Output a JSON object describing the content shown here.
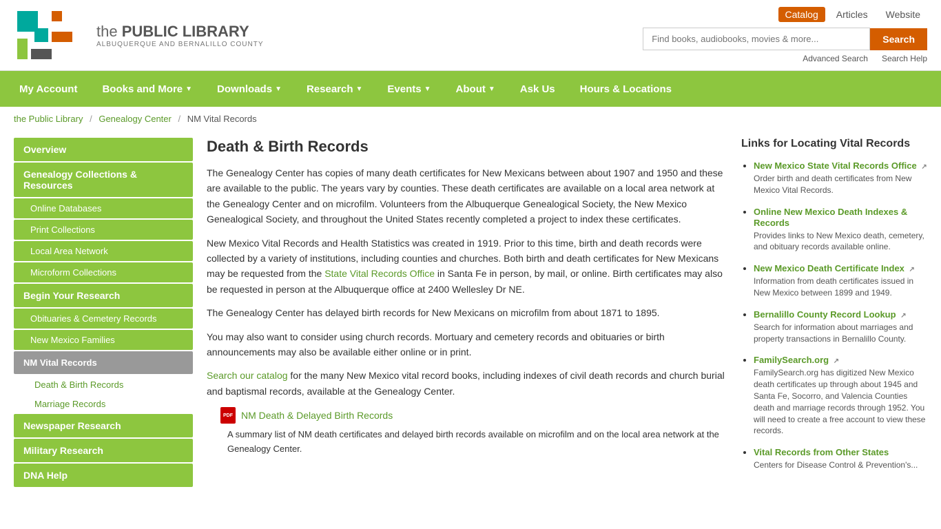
{
  "header": {
    "logo_title_the": "the ",
    "logo_title_main": "PUBLIC LIBRARY",
    "logo_subtitle": "ALBUQUERQUE and BERNALILLO COUNTY",
    "search_tabs": [
      {
        "label": "Catalog",
        "active": true
      },
      {
        "label": "Articles",
        "active": false
      },
      {
        "label": "Website",
        "active": false
      }
    ],
    "search_placeholder": "Find books, audiobooks, movies & more...",
    "search_button": "Search",
    "advanced_search": "Advanced Search",
    "search_help": "Search Help"
  },
  "nav": {
    "items": [
      {
        "label": "My Account",
        "has_arrow": false
      },
      {
        "label": "Books and More",
        "has_arrow": true
      },
      {
        "label": "Downloads",
        "has_arrow": true
      },
      {
        "label": "Research",
        "has_arrow": true
      },
      {
        "label": "Events",
        "has_arrow": true
      },
      {
        "label": "About",
        "has_arrow": true
      },
      {
        "label": "Ask Us",
        "has_arrow": false
      },
      {
        "label": "Hours & Locations",
        "has_arrow": false
      }
    ]
  },
  "breadcrumb": {
    "items": [
      {
        "label": "the Public Library",
        "link": true
      },
      {
        "label": "Genealogy Center",
        "link": true
      },
      {
        "label": "NM Vital Records",
        "link": false
      }
    ]
  },
  "sidebar": {
    "items": [
      {
        "label": "Overview",
        "type": "main"
      },
      {
        "label": "Genealogy Collections & Resources",
        "type": "main"
      },
      {
        "label": "Online Databases",
        "type": "sub"
      },
      {
        "label": "Print Collections",
        "type": "sub"
      },
      {
        "label": "Local Area Network",
        "type": "sub"
      },
      {
        "label": "Microform Collections",
        "type": "sub"
      },
      {
        "label": "Begin Your Research",
        "type": "main"
      },
      {
        "label": "Obituaries & Cemetery Records",
        "type": "sub"
      },
      {
        "label": "New Mexico Families",
        "type": "sub"
      },
      {
        "label": "NM Vital Records",
        "type": "active"
      },
      {
        "label": "Death & Birth Records",
        "type": "child"
      },
      {
        "label": "Marriage Records",
        "type": "child"
      },
      {
        "label": "Newspaper Research",
        "type": "main"
      },
      {
        "label": "Military Research",
        "type": "main"
      },
      {
        "label": "DNA Help",
        "type": "main"
      }
    ]
  },
  "main": {
    "title": "Death & Birth Records",
    "paragraphs": [
      "The Genealogy Center has copies of many death certificates for New Mexicans between about 1907 and 1950 and these are available to the public. The years vary by counties. These death certificates are available on a local area network at the Genealogy Center and on microfilm. Volunteers from the Albuquerque Genealogical Society, the New Mexico Genealogical Society, and throughout the United States recently completed a project to index these certificates.",
      "New Mexico Vital Records and Health Statistics was created in 1919.  Prior to this time, birth and death records were collected by a variety of institutions, including counties and churches. Both birth and death certificates for New Mexicans may be requested from the State Vital Records Office in Santa Fe in person, by mail, or online.  Birth certificates may also be requested in person at the Albuquerque office at 2400 Wellesley Dr NE.",
      "The Genealogy Center has delayed birth records for New Mexicans on microfilm from about 1871 to 1895.",
      "You may also want to consider using church records.  Mortuary and cemetery records and obituaries or birth announcements may also be available either online or in print.",
      "Search our catalog for the many New Mexico vital record books, including indexes of civil death records and church burial and baptismal records, available at the Genealogy Center."
    ],
    "pdf_link_label": "NM Death & Delayed Birth Records",
    "pdf_description": "A summary list of NM death certificates and delayed birth records available on microfilm and on the local area network at the Genealogy Center."
  },
  "right_panel": {
    "title": "Links for Locating Vital Records",
    "links": [
      {
        "label": "New Mexico State Vital Records Office",
        "description": "Order birth and death certificates from New Mexico Vital Records."
      },
      {
        "label": "Online New Mexico Death Indexes & Records",
        "description": "Provides links to New Mexico death, cemetery, and obituary records available online."
      },
      {
        "label": "New Mexico Death Certificate Index",
        "description": "Information from death certificates issued in New Mexico between 1899 and 1949."
      },
      {
        "label": "Bernalillo County Record Lookup",
        "description": "Search for information about marriages and property transactions in Bernalillo County."
      },
      {
        "label": "FamilySearch.org",
        "description": "FamilySearch.org has digitized New Mexico death certificates up through about 1945 and Santa Fe, Socorro, and Valencia Counties death and marriage records through 1952. You will need to create a free account to view these records."
      },
      {
        "label": "Vital Records from Other States",
        "description": "Centers for Disease Control & Prevention's..."
      }
    ]
  }
}
